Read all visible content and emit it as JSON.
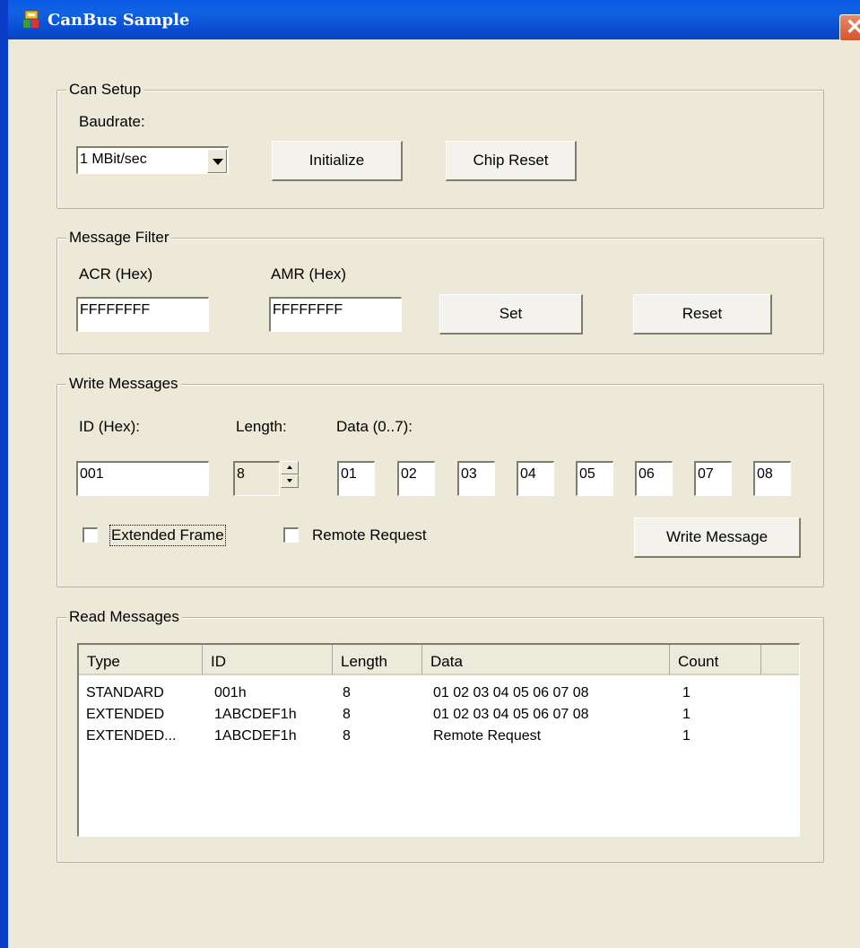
{
  "window": {
    "title": "CanBus Sample"
  },
  "can_setup": {
    "legend": "Can Setup",
    "baudrate_label": "Baudrate:",
    "baudrate_value": "1 MBit/sec",
    "initialize_label": "Initialize",
    "chip_reset_label": "Chip Reset"
  },
  "message_filter": {
    "legend": "Message Filter",
    "acr_label": "ACR (Hex)",
    "acr_value": "FFFFFFFF",
    "amr_label": "AMR (Hex)",
    "amr_value": "FFFFFFFF",
    "set_label": "Set",
    "reset_label": "Reset"
  },
  "write_messages": {
    "legend": "Write Messages",
    "id_label": "ID (Hex):",
    "id_value": "001",
    "length_label": "Length:",
    "length_value": "8",
    "data_label": "Data (0..7):",
    "data": [
      "01",
      "02",
      "03",
      "04",
      "05",
      "06",
      "07",
      "08"
    ],
    "extended_frame_label": "Extended Frame",
    "extended_frame_checked": false,
    "remote_request_label": "Remote Request",
    "remote_request_checked": false,
    "write_button_label": "Write Message"
  },
  "read_messages": {
    "legend": "Read Messages",
    "columns": [
      "Type",
      "ID",
      "Length",
      "Data",
      "Count"
    ],
    "rows": [
      [
        "STANDARD",
        "001h",
        "8",
        "01 02 03 04 05 06 07 08",
        "1"
      ],
      [
        "EXTENDED",
        "1ABCDEF1h",
        "8",
        "01 02 03 04 05 06 07 08",
        "1"
      ],
      [
        "EXTENDED...",
        "1ABCDEF1h",
        "8",
        "Remote Request",
        "1"
      ]
    ]
  }
}
